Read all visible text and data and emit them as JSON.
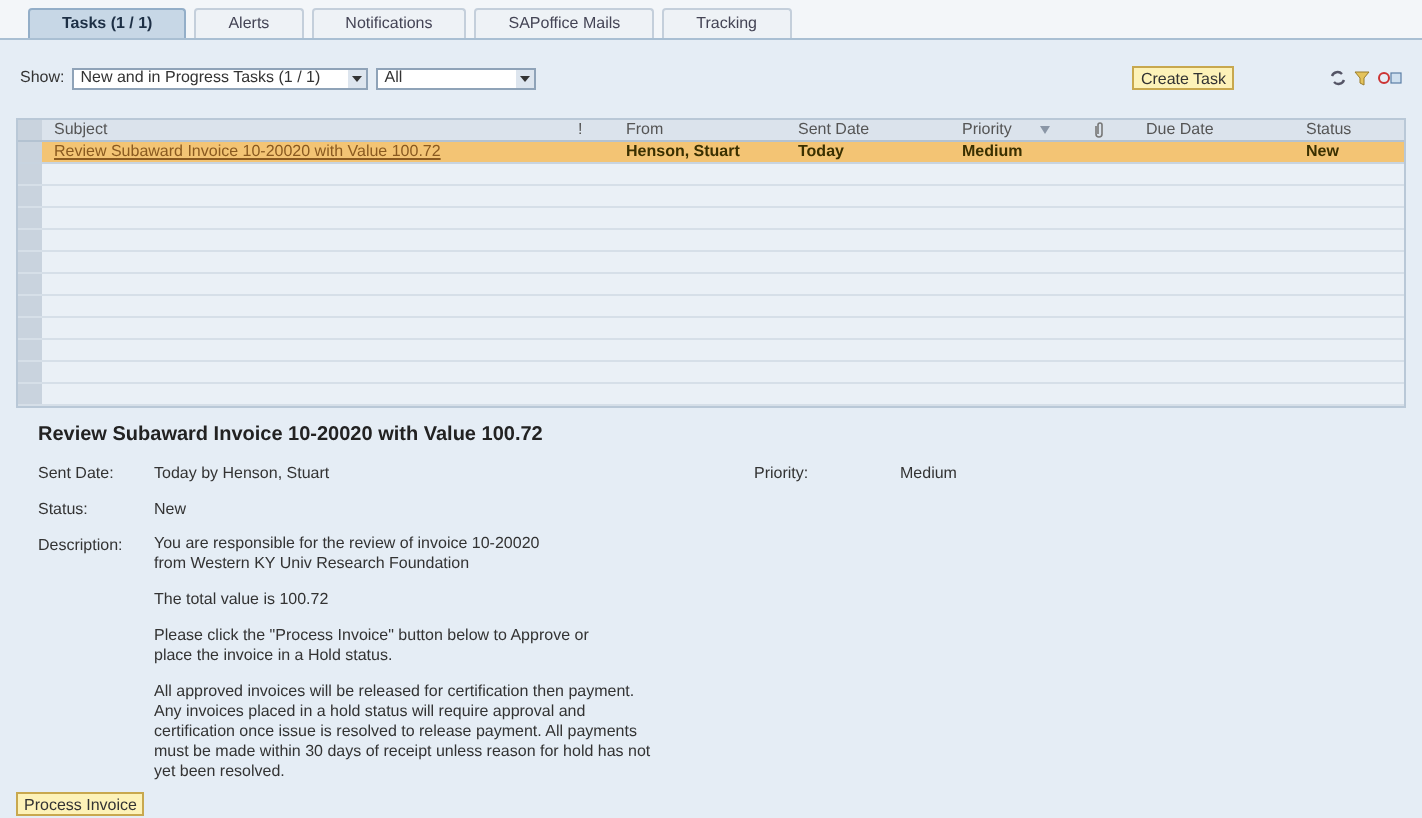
{
  "tabs": [
    {
      "label": "Tasks (1 / 1)",
      "selected": true
    },
    {
      "label": "Alerts",
      "selected": false
    },
    {
      "label": "Notifications",
      "selected": false
    },
    {
      "label": "SAPoffice Mails",
      "selected": false
    },
    {
      "label": "Tracking",
      "selected": false
    }
  ],
  "toolbar": {
    "show_label": "Show:",
    "filter": "New and in Progress Tasks  (1 / 1)",
    "scope": "All",
    "create_button": "Create Task"
  },
  "table": {
    "columns": [
      {
        "kind": "text",
        "label": "Subject"
      },
      {
        "kind": "text",
        "label": "!"
      },
      {
        "kind": "text",
        "label": "From"
      },
      {
        "kind": "text",
        "label": "Sent Date"
      },
      {
        "kind": "text",
        "label": "Priority",
        "sorted": true
      },
      {
        "kind": "attachment"
      },
      {
        "kind": "text",
        "label": "Due Date"
      },
      {
        "kind": "text",
        "label": "Status"
      }
    ],
    "rows": [
      {
        "selected": true,
        "cells": [
          "Review Subaward Invoice 10-20020 with Value 100.72",
          "",
          "Henson, Stuart",
          "Today",
          "Medium",
          "",
          "",
          "New"
        ]
      }
    ]
  },
  "details": {
    "title": "Review Subaward Invoice 10-20020 with Value 100.72",
    "sent_date": {
      "label": "Sent Date:",
      "value": "Today by Henson, Stuart"
    },
    "priority": {
      "label": "Priority:",
      "value": "Medium"
    },
    "status": {
      "label": "Status:",
      "value": "New"
    },
    "description": {
      "label": "Description:",
      "paragraphs": [
        [
          "You are responsible for the review of invoice 10-20020",
          "from Western KY Univ Research Foundation"
        ],
        [
          "The total value is 100.72"
        ],
        [
          "Please click the \"Process Invoice\" button below to Approve or",
          "place the invoice in a Hold status."
        ],
        [
          "All approved invoices will be released for certification then payment.",
          "Any invoices placed in a hold status will require approval and",
          "certification once issue is resolved to release payment. All payments",
          "must be made within 30 days of receipt unless reason for hold has not",
          "yet been resolved."
        ]
      ]
    },
    "button": "Process Invoice"
  }
}
